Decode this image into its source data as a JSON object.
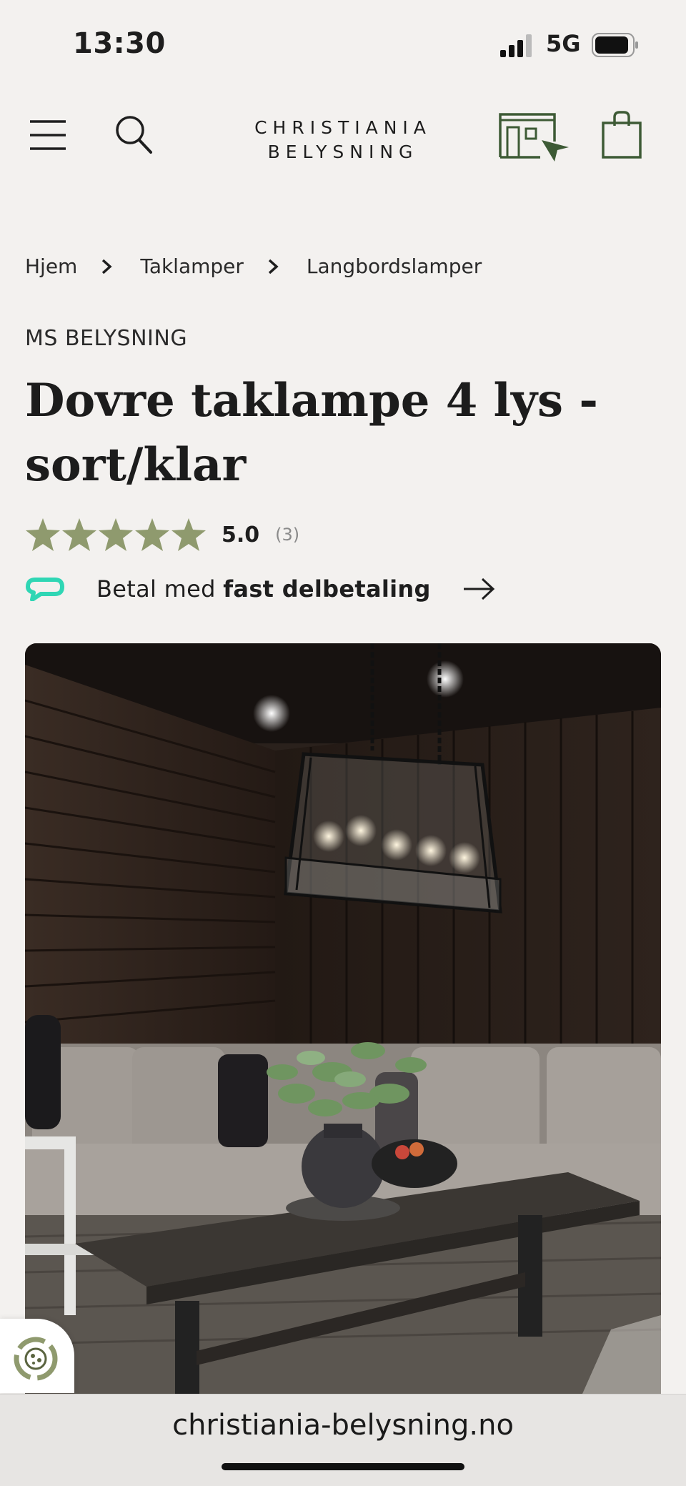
{
  "status_bar": {
    "time": "13:30",
    "network": "5G"
  },
  "header": {
    "logo_line1": "CHRISTIANIA",
    "logo_line2": "BELYSNING"
  },
  "breadcrumb": [
    {
      "label": "Hjem"
    },
    {
      "label": "Taklamper"
    },
    {
      "label": "Langbordslamper"
    }
  ],
  "product": {
    "brand": "MS BELYSNING",
    "title": "Dovre taklampe 4 lys - sort/klar",
    "rating_value": "5.0",
    "rating_count": "(3)",
    "stars": 5
  },
  "payment": {
    "text_regular": "Betal med ",
    "text_bold": "fast delbetaling"
  },
  "browser": {
    "url": "christiania-belysning.no"
  },
  "colors": {
    "background": "#f3f1ef",
    "star": "#8f9a6e",
    "brand_green": "#3d5a35",
    "klarna_teal": "#2fd6b4"
  },
  "icons": [
    "menu-icon",
    "search-icon",
    "showroom-icon",
    "cart-icon",
    "chevron-right-icon",
    "star-icon",
    "klarna-icon",
    "arrow-right-icon",
    "cookie-icon"
  ]
}
